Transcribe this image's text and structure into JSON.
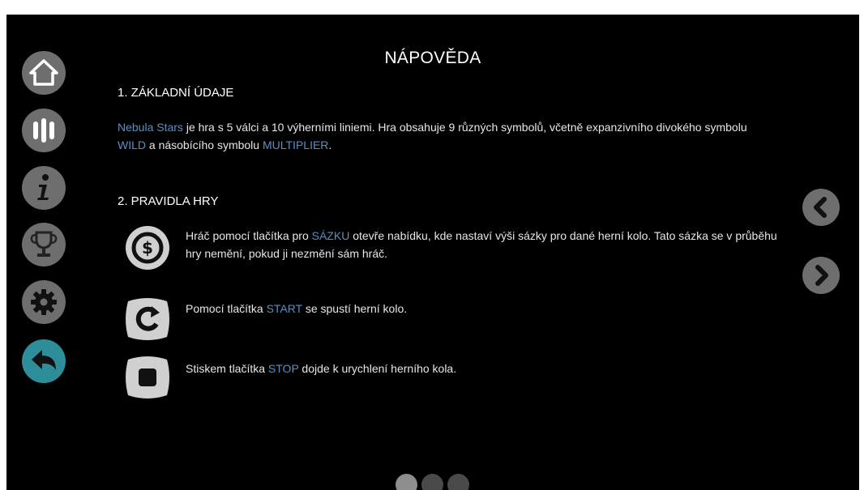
{
  "help": {
    "title": "NÁPOVĚDA",
    "section1": {
      "heading": "1. ZÁKLADNÍ ÚDAJE",
      "game_name": "Nebula Stars",
      "text_a": " je hra s 5 válci a 10 výherními liniemi. Hra obsahuje 9 různých symbolů, včetně expanzivního divokého symbolu ",
      "wild": "WILD",
      "text_b": " a násobícího symbolu ",
      "multiplier": "MULTIPLIER",
      "text_c": "."
    },
    "section2": {
      "heading": "2. PRAVIDLA HRY",
      "rules": [
        {
          "icon": "bet-coin-icon",
          "pre": "Hráč pomocí tlačítka pro ",
          "keyword": "SÁZKU",
          "post": " otevře nabídku, kde nastaví výši sázky pro dané herní kolo. Tato sázka se v průběhu hry nemění, pokud ji nezmění sám hráč."
        },
        {
          "icon": "start-spin-icon",
          "pre": "Pomocí tlačítka ",
          "keyword": "START",
          "post": " se spustí herní kolo."
        },
        {
          "icon": "stop-icon",
          "pre": "Stiskem tlačítka ",
          "keyword": "STOP",
          "post": " dojde k urychlení herního kola."
        }
      ]
    }
  },
  "sidebar": {
    "items": [
      {
        "name": "home-icon"
      },
      {
        "name": "paytable-icon"
      },
      {
        "name": "info-icon"
      },
      {
        "name": "trophy-icon"
      },
      {
        "name": "settings-icon"
      },
      {
        "name": "back-icon"
      }
    ],
    "active_index": 5
  },
  "pagination": {
    "total": 3,
    "current": 1
  },
  "colors": {
    "background": "#000000",
    "button_gray": "#6e6e6e",
    "accent_teal": "#2d8e99",
    "keyword_blue": "#5a8fc4"
  }
}
